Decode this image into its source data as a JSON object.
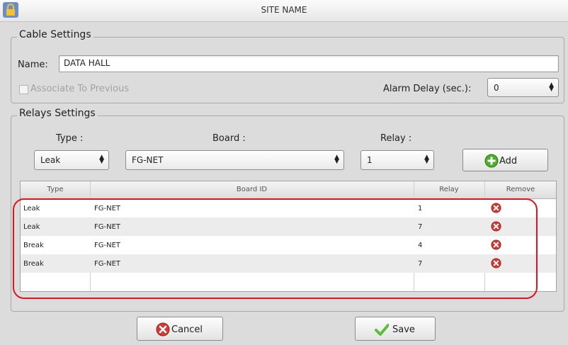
{
  "window": {
    "title": "SITE NAME",
    "icon": "lock-icon"
  },
  "cable_settings": {
    "legend": "Cable Settings",
    "name_label": "Name:",
    "name_value": "DATA HALL",
    "associate_label": "Associate To Previous",
    "associate_checked": false,
    "alarm_delay_label": "Alarm Delay (sec.):",
    "alarm_delay_value": "0"
  },
  "relays_settings": {
    "legend": "Relays Settings",
    "type_label": "Type :",
    "board_label": "Board :",
    "relay_label": "Relay :",
    "type_value": "Leak",
    "board_value": "FG-NET",
    "relay_value": "1",
    "add_label": "Add"
  },
  "table": {
    "headers": [
      "Type",
      "Board ID",
      "Relay",
      "Remove"
    ],
    "rows": [
      {
        "type": "Leak",
        "board": "FG-NET",
        "relay": "1"
      },
      {
        "type": "Leak",
        "board": "FG-NET",
        "relay": "7"
      },
      {
        "type": "Break",
        "board": "FG-NET",
        "relay": "4"
      },
      {
        "type": "Break",
        "board": "FG-NET",
        "relay": "7"
      }
    ]
  },
  "footer": {
    "cancel_label": "Cancel",
    "save_label": "Save"
  },
  "colors": {
    "highlight": "#e0141e",
    "remove_icon": "#d43a34",
    "add_icon": "#4caf2a",
    "save_icon": "#5bbf3a"
  }
}
